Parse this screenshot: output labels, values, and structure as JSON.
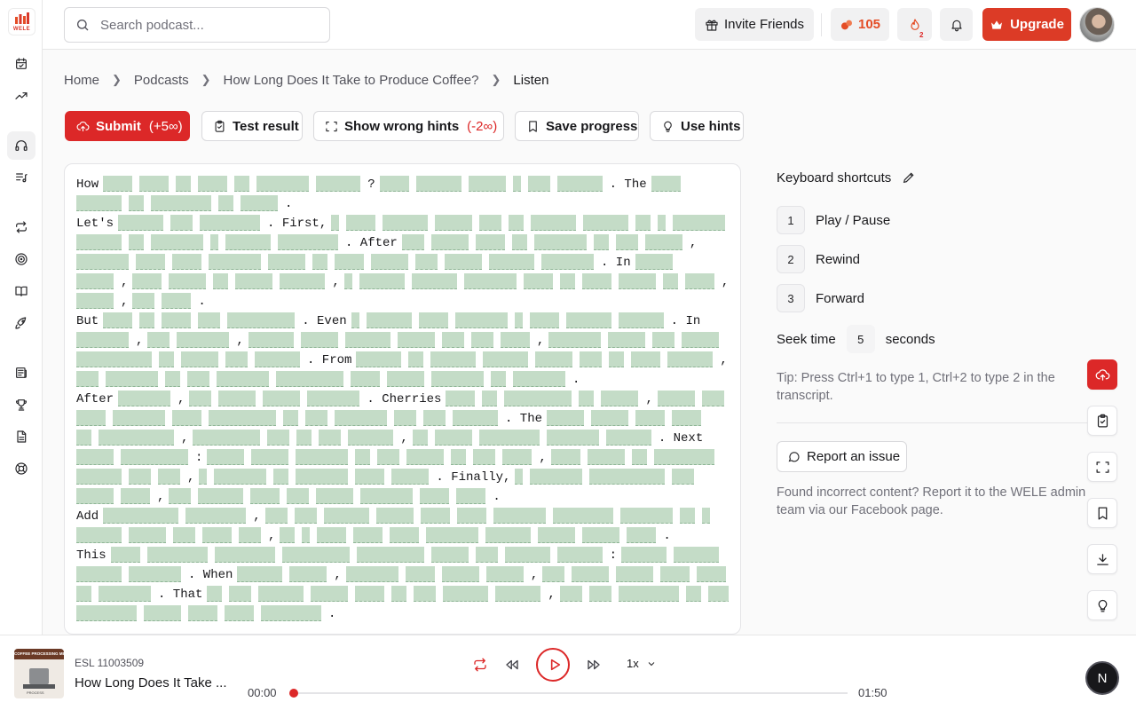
{
  "brand": {
    "logo_text": "WELE",
    "accent": "#dc2828",
    "gap_color": "#c4dcc7"
  },
  "rail": {
    "items": [
      {
        "name": "calendar-check-icon",
        "active": false
      },
      {
        "name": "trending-up-icon",
        "active": false
      },
      {
        "name": "headphones-icon",
        "active": true
      },
      {
        "name": "list-music-icon",
        "active": false
      },
      {
        "name": "repeat-icon",
        "active": false
      },
      {
        "name": "target-icon",
        "active": false
      },
      {
        "name": "book-open-icon",
        "active": false
      },
      {
        "name": "rocket-icon",
        "active": false
      },
      {
        "name": "newspaper-icon",
        "active": false
      },
      {
        "name": "trophy-icon",
        "active": false
      },
      {
        "name": "file-text-icon",
        "active": false
      },
      {
        "name": "help-buoy-icon",
        "active": false
      }
    ]
  },
  "header": {
    "search_placeholder": "Search podcast...",
    "invite_label": "Invite Friends",
    "streak_count": "105",
    "fire_badge": "2",
    "upgrade_label": "Upgrade"
  },
  "breadcrumb": {
    "home": "Home",
    "podcasts": "Podcasts",
    "episode": "How Long Does It Take to Produce Coffee?",
    "current": "Listen"
  },
  "toolbar": {
    "submit_label": "Submit",
    "submit_bonus": "(+5",
    "submit_bonus_close": ")",
    "test_label": "Test result",
    "wrong_hints_label": "Show wrong hints",
    "wrong_hints_penalty": "(-2",
    "wrong_hints_penalty_close": ")",
    "save_label": "Save progress",
    "hints_label": "Use hints"
  },
  "transcript": {
    "lines": [
      [
        {
          "w": "How"
        },
        {
          "g": 33
        },
        {
          "g": 33
        },
        {
          "g": 17
        },
        {
          "g": 33
        },
        {
          "g": 17
        },
        {
          "g": 59
        },
        {
          "g": 50
        },
        {
          "w": "?"
        },
        {
          "g": 33
        },
        {
          "g": 51
        },
        {
          "g": 42
        },
        {
          "g": 9
        },
        {
          "g": 25
        },
        {
          "g": 51
        },
        {
          "w": ". The"
        },
        {
          "g": 33
        }
      ],
      [
        {
          "g": 51
        },
        {
          "g": 17
        },
        {
          "g": 68
        },
        {
          "g": 17
        },
        {
          "g": 42
        },
        {
          "w": "."
        }
      ],
      [
        {
          "w": "Let's"
        },
        {
          "g": 51
        },
        {
          "g": 25
        },
        {
          "g": 68
        },
        {
          "w": ". First,"
        },
        {
          "g": 9
        },
        {
          "g": 33
        },
        {
          "g": 51
        },
        {
          "g": 42
        },
        {
          "g": 25
        },
        {
          "g": 17
        },
        {
          "g": 51
        },
        {
          "g": 51
        },
        {
          "g": 17
        },
        {
          "g": 9
        },
        {
          "g": 59
        }
      ],
      [
        {
          "g": 51
        },
        {
          "g": 17
        },
        {
          "g": 59
        },
        {
          "g": 9
        },
        {
          "g": 51
        },
        {
          "g": 68
        },
        {
          "w": ". After"
        },
        {
          "g": 25
        },
        {
          "g": 42
        },
        {
          "g": 33
        },
        {
          "g": 17
        },
        {
          "g": 59
        },
        {
          "g": 17
        },
        {
          "g": 25
        },
        {
          "g": 42
        },
        {
          "w": ","
        }
      ],
      [
        {
          "g": 59
        },
        {
          "g": 33
        },
        {
          "g": 33
        },
        {
          "g": 59
        },
        {
          "g": 42
        },
        {
          "g": 17
        },
        {
          "g": 33
        },
        {
          "g": 42
        },
        {
          "g": 25
        },
        {
          "g": 42
        },
        {
          "g": 51
        },
        {
          "g": 59
        },
        {
          "w": ". In"
        },
        {
          "g": 42
        }
      ],
      [
        {
          "g": 42
        },
        {
          "w": ","
        },
        {
          "g": 33
        },
        {
          "g": 42
        },
        {
          "g": 17
        },
        {
          "g": 42
        },
        {
          "g": 51
        },
        {
          "w": ","
        },
        {
          "g": 9
        },
        {
          "g": 51
        },
        {
          "g": 51
        },
        {
          "g": 59
        },
        {
          "g": 33
        },
        {
          "g": 17
        },
        {
          "g": 33
        },
        {
          "g": 42
        },
        {
          "g": 17
        },
        {
          "g": 33
        },
        {
          "w": ","
        }
      ],
      [
        {
          "g": 42
        },
        {
          "w": ","
        },
        {
          "g": 25
        },
        {
          "g": 33
        },
        {
          "w": "."
        }
      ],
      [
        {
          "w": "But"
        },
        {
          "g": 33
        },
        {
          "g": 17
        },
        {
          "g": 33
        },
        {
          "g": 25
        },
        {
          "g": 76
        },
        {
          "w": ". Even"
        },
        {
          "g": 9
        },
        {
          "g": 51
        },
        {
          "g": 33
        },
        {
          "g": 59
        },
        {
          "g": 9
        },
        {
          "g": 33
        },
        {
          "g": 51
        },
        {
          "g": 51
        },
        {
          "w": ". In"
        }
      ],
      [
        {
          "g": 59
        },
        {
          "w": ","
        },
        {
          "g": 25
        },
        {
          "g": 59
        },
        {
          "w": ","
        },
        {
          "g": 51
        },
        {
          "g": 42
        },
        {
          "g": 51
        },
        {
          "g": 42
        },
        {
          "g": 25
        },
        {
          "g": 25
        },
        {
          "g": 33
        },
        {
          "w": ","
        },
        {
          "g": 59
        },
        {
          "g": 42
        },
        {
          "g": 25
        },
        {
          "g": 42
        }
      ],
      [
        {
          "g": 85
        },
        {
          "g": 17
        },
        {
          "g": 42
        },
        {
          "g": 25
        },
        {
          "g": 51
        },
        {
          "w": ". From"
        },
        {
          "g": 51
        },
        {
          "g": 17
        },
        {
          "g": 51
        },
        {
          "g": 51
        },
        {
          "g": 42
        },
        {
          "g": 25
        },
        {
          "g": 17
        },
        {
          "g": 33
        },
        {
          "g": 51
        },
        {
          "w": ","
        },
        {
          "g": 25
        }
      ],
      [
        {
          "g": 25
        },
        {
          "g": 59
        },
        {
          "g": 17
        },
        {
          "g": 25
        },
        {
          "g": 59
        },
        {
          "g": 76
        },
        {
          "g": 33
        },
        {
          "g": 42
        },
        {
          "g": 59
        },
        {
          "g": 17
        },
        {
          "g": 59
        },
        {
          "w": "."
        }
      ],
      [
        {
          "w": "After"
        },
        {
          "g": 59
        },
        {
          "w": ","
        },
        {
          "g": 25
        },
        {
          "g": 42
        },
        {
          "g": 42
        },
        {
          "g": 59
        },
        {
          "w": ". Cherries"
        },
        {
          "g": 33
        },
        {
          "g": 17
        },
        {
          "g": 76
        },
        {
          "g": 17
        },
        {
          "g": 42
        },
        {
          "w": ","
        },
        {
          "g": 42
        },
        {
          "g": 25
        }
      ],
      [
        {
          "g": 33
        },
        {
          "g": 59
        },
        {
          "g": 33
        },
        {
          "g": 76
        },
        {
          "g": 17
        },
        {
          "g": 25
        },
        {
          "g": 59
        },
        {
          "g": 25
        },
        {
          "g": 25
        },
        {
          "g": 51
        },
        {
          "w": ". The"
        },
        {
          "g": 42
        },
        {
          "g": 42
        },
        {
          "g": 33
        },
        {
          "g": 33
        }
      ],
      [
        {
          "g": 17
        },
        {
          "g": 85
        },
        {
          "w": ","
        },
        {
          "g": 76
        },
        {
          "g": 25
        },
        {
          "g": 17
        },
        {
          "g": 25
        },
        {
          "g": 51
        },
        {
          "w": ","
        },
        {
          "g": 17
        },
        {
          "g": 42
        },
        {
          "g": 68
        },
        {
          "g": 59
        },
        {
          "g": 51
        },
        {
          "w": ". Next"
        }
      ],
      [
        {
          "g": 42
        },
        {
          "g": 76
        },
        {
          "w": ":"
        },
        {
          "g": 42
        },
        {
          "g": 42
        },
        {
          "g": 59
        },
        {
          "g": 17
        },
        {
          "g": 25
        },
        {
          "g": 42
        },
        {
          "g": 17
        },
        {
          "g": 25
        },
        {
          "g": 33
        },
        {
          "w": ","
        },
        {
          "g": 33
        },
        {
          "g": 42
        },
        {
          "g": 17
        },
        {
          "g": 68
        }
      ],
      [
        {
          "g": 51
        },
        {
          "g": 25
        },
        {
          "g": 25
        },
        {
          "w": ","
        },
        {
          "g": 9
        },
        {
          "g": 59
        },
        {
          "g": 17
        },
        {
          "g": 59
        },
        {
          "g": 33
        },
        {
          "g": 42
        },
        {
          "w": ". Finally,"
        },
        {
          "g": 9
        },
        {
          "g": 59
        },
        {
          "g": 85
        },
        {
          "g": 25
        }
      ],
      [
        {
          "g": 42
        },
        {
          "g": 33
        },
        {
          "w": ","
        },
        {
          "g": 25
        },
        {
          "g": 51
        },
        {
          "g": 33
        },
        {
          "g": 25
        },
        {
          "g": 42
        },
        {
          "g": 59
        },
        {
          "g": 33
        },
        {
          "g": 33
        },
        {
          "w": "."
        }
      ],
      [
        {
          "w": "Add"
        },
        {
          "g": 85
        },
        {
          "g": 68
        },
        {
          "w": ","
        },
        {
          "g": 25
        },
        {
          "g": 25
        },
        {
          "g": 51
        },
        {
          "g": 42
        },
        {
          "g": 33
        },
        {
          "g": 33
        },
        {
          "g": 59
        },
        {
          "g": 68
        },
        {
          "g": 59
        },
        {
          "g": 17
        },
        {
          "g": 9
        }
      ],
      [
        {
          "g": 51
        },
        {
          "g": 42
        },
        {
          "g": 25
        },
        {
          "g": 33
        },
        {
          "g": 25
        },
        {
          "w": ","
        },
        {
          "g": 17
        },
        {
          "g": 9
        },
        {
          "g": 33
        },
        {
          "g": 33
        },
        {
          "g": 33
        },
        {
          "g": 59
        },
        {
          "g": 51
        },
        {
          "g": 42
        },
        {
          "g": 42
        },
        {
          "g": 33
        },
        {
          "w": "."
        }
      ],
      [
        {
          "w": "This"
        },
        {
          "g": 33
        },
        {
          "g": 68
        },
        {
          "g": 68
        },
        {
          "g": 76
        },
        {
          "g": 76
        },
        {
          "g": 42
        },
        {
          "g": 25
        },
        {
          "g": 51
        },
        {
          "g": 51
        },
        {
          "w": ":"
        },
        {
          "g": 51
        },
        {
          "g": 51
        }
      ],
      [
        {
          "g": 51
        },
        {
          "g": 59
        },
        {
          "w": ". When"
        },
        {
          "g": 51
        },
        {
          "g": 42
        },
        {
          "w": ","
        },
        {
          "g": 59
        },
        {
          "g": 33
        },
        {
          "g": 42
        },
        {
          "g": 42
        },
        {
          "w": ","
        },
        {
          "g": 25
        },
        {
          "g": 42
        },
        {
          "g": 42
        },
        {
          "g": 33
        },
        {
          "g": 33
        },
        {
          "g": 33
        }
      ],
      [
        {
          "g": 17
        },
        {
          "g": 59
        },
        {
          "w": ". That"
        },
        {
          "g": 17
        },
        {
          "g": 25
        },
        {
          "g": 51
        },
        {
          "g": 42
        },
        {
          "g": 33
        },
        {
          "g": 17
        },
        {
          "g": 25
        },
        {
          "g": 51
        },
        {
          "g": 51
        },
        {
          "w": ","
        },
        {
          "g": 25
        },
        {
          "g": 25
        },
        {
          "g": 68
        },
        {
          "g": 17
        },
        {
          "g": 25
        },
        {
          "g": 33
        }
      ],
      [
        {
          "g": 68
        },
        {
          "g": 42
        },
        {
          "g": 33
        },
        {
          "g": 33
        },
        {
          "g": 68
        },
        {
          "w": "."
        }
      ]
    ]
  },
  "shortcuts": {
    "title": "Keyboard shortcuts",
    "items": [
      {
        "key": "1",
        "label": "Play / Pause"
      },
      {
        "key": "2",
        "label": "Rewind"
      },
      {
        "key": "3",
        "label": "Forward"
      }
    ],
    "seek_label": "Seek time",
    "seek_value": "5",
    "seek_unit": "seconds",
    "tip": "Tip: Press Ctrl+1 to type 1, Ctrl+2 to type 2 in the transcript."
  },
  "report": {
    "button_label": "Report an issue",
    "description": "Found incorrect content? Report it to the WELE admin team via our Facebook page."
  },
  "player": {
    "thumbnail_caption": "COFFEE PROCESSING METHODS",
    "thumbnail_footer": "PROCESS",
    "episode_code": "ESL 11003509",
    "episode_title": "How Long Does It Take ...",
    "speed": "1x",
    "current_time": "00:00",
    "duration": "01:50",
    "progress": 0,
    "user_initial": "N"
  }
}
